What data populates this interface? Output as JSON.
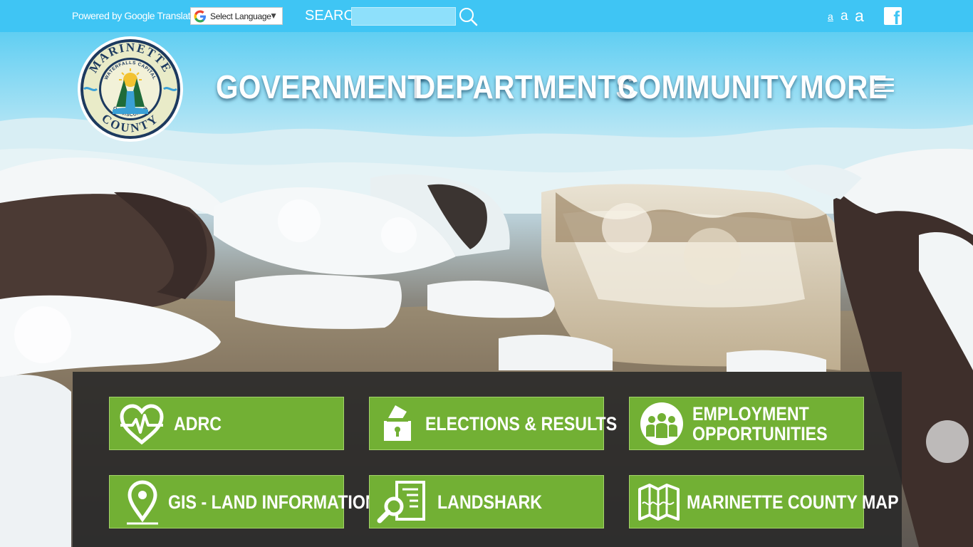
{
  "topbar": {
    "powered_by": "Powered by Google Translate",
    "language_select": "Select Language",
    "search_label": "SEARCH",
    "search_placeholder": "",
    "text_size_small": "a",
    "text_size_medium": "a",
    "text_size_large": "a",
    "social_icon": "facebook-icon"
  },
  "logo": {
    "top_text": "MARINETTE",
    "ring_text": "WATERFALLS CAPITAL",
    "ring_bottom": "OF WISCONSIN",
    "bottom_text": "COUNTY"
  },
  "nav": {
    "items": [
      {
        "label": "GOVERNMENT"
      },
      {
        "label": "DEPARTMENTS"
      },
      {
        "label": "COMMUNITY"
      },
      {
        "label": "MORE"
      }
    ],
    "menu_icon": "hamburger-menu-icon"
  },
  "quick_links": [
    {
      "label": "ADRC",
      "icon": "heart-pulse-icon"
    },
    {
      "label": "ELECTIONS & RESULTS",
      "icon": "ballot-box-icon"
    },
    {
      "label_line1": "EMPLOYMENT",
      "label_line2": "OPPORTUNITIES",
      "icon": "people-group-icon"
    },
    {
      "label": "GIS - LAND INFORMATION",
      "icon": "map-pin-icon"
    },
    {
      "label": "LANDSHARK",
      "icon": "document-search-icon"
    },
    {
      "label": "MARINETTE COUNTY MAP",
      "icon": "folded-map-icon"
    }
  ],
  "colors": {
    "topbar": "#3fc5f4",
    "tile_green": "#72b034",
    "panel": "#282828"
  }
}
